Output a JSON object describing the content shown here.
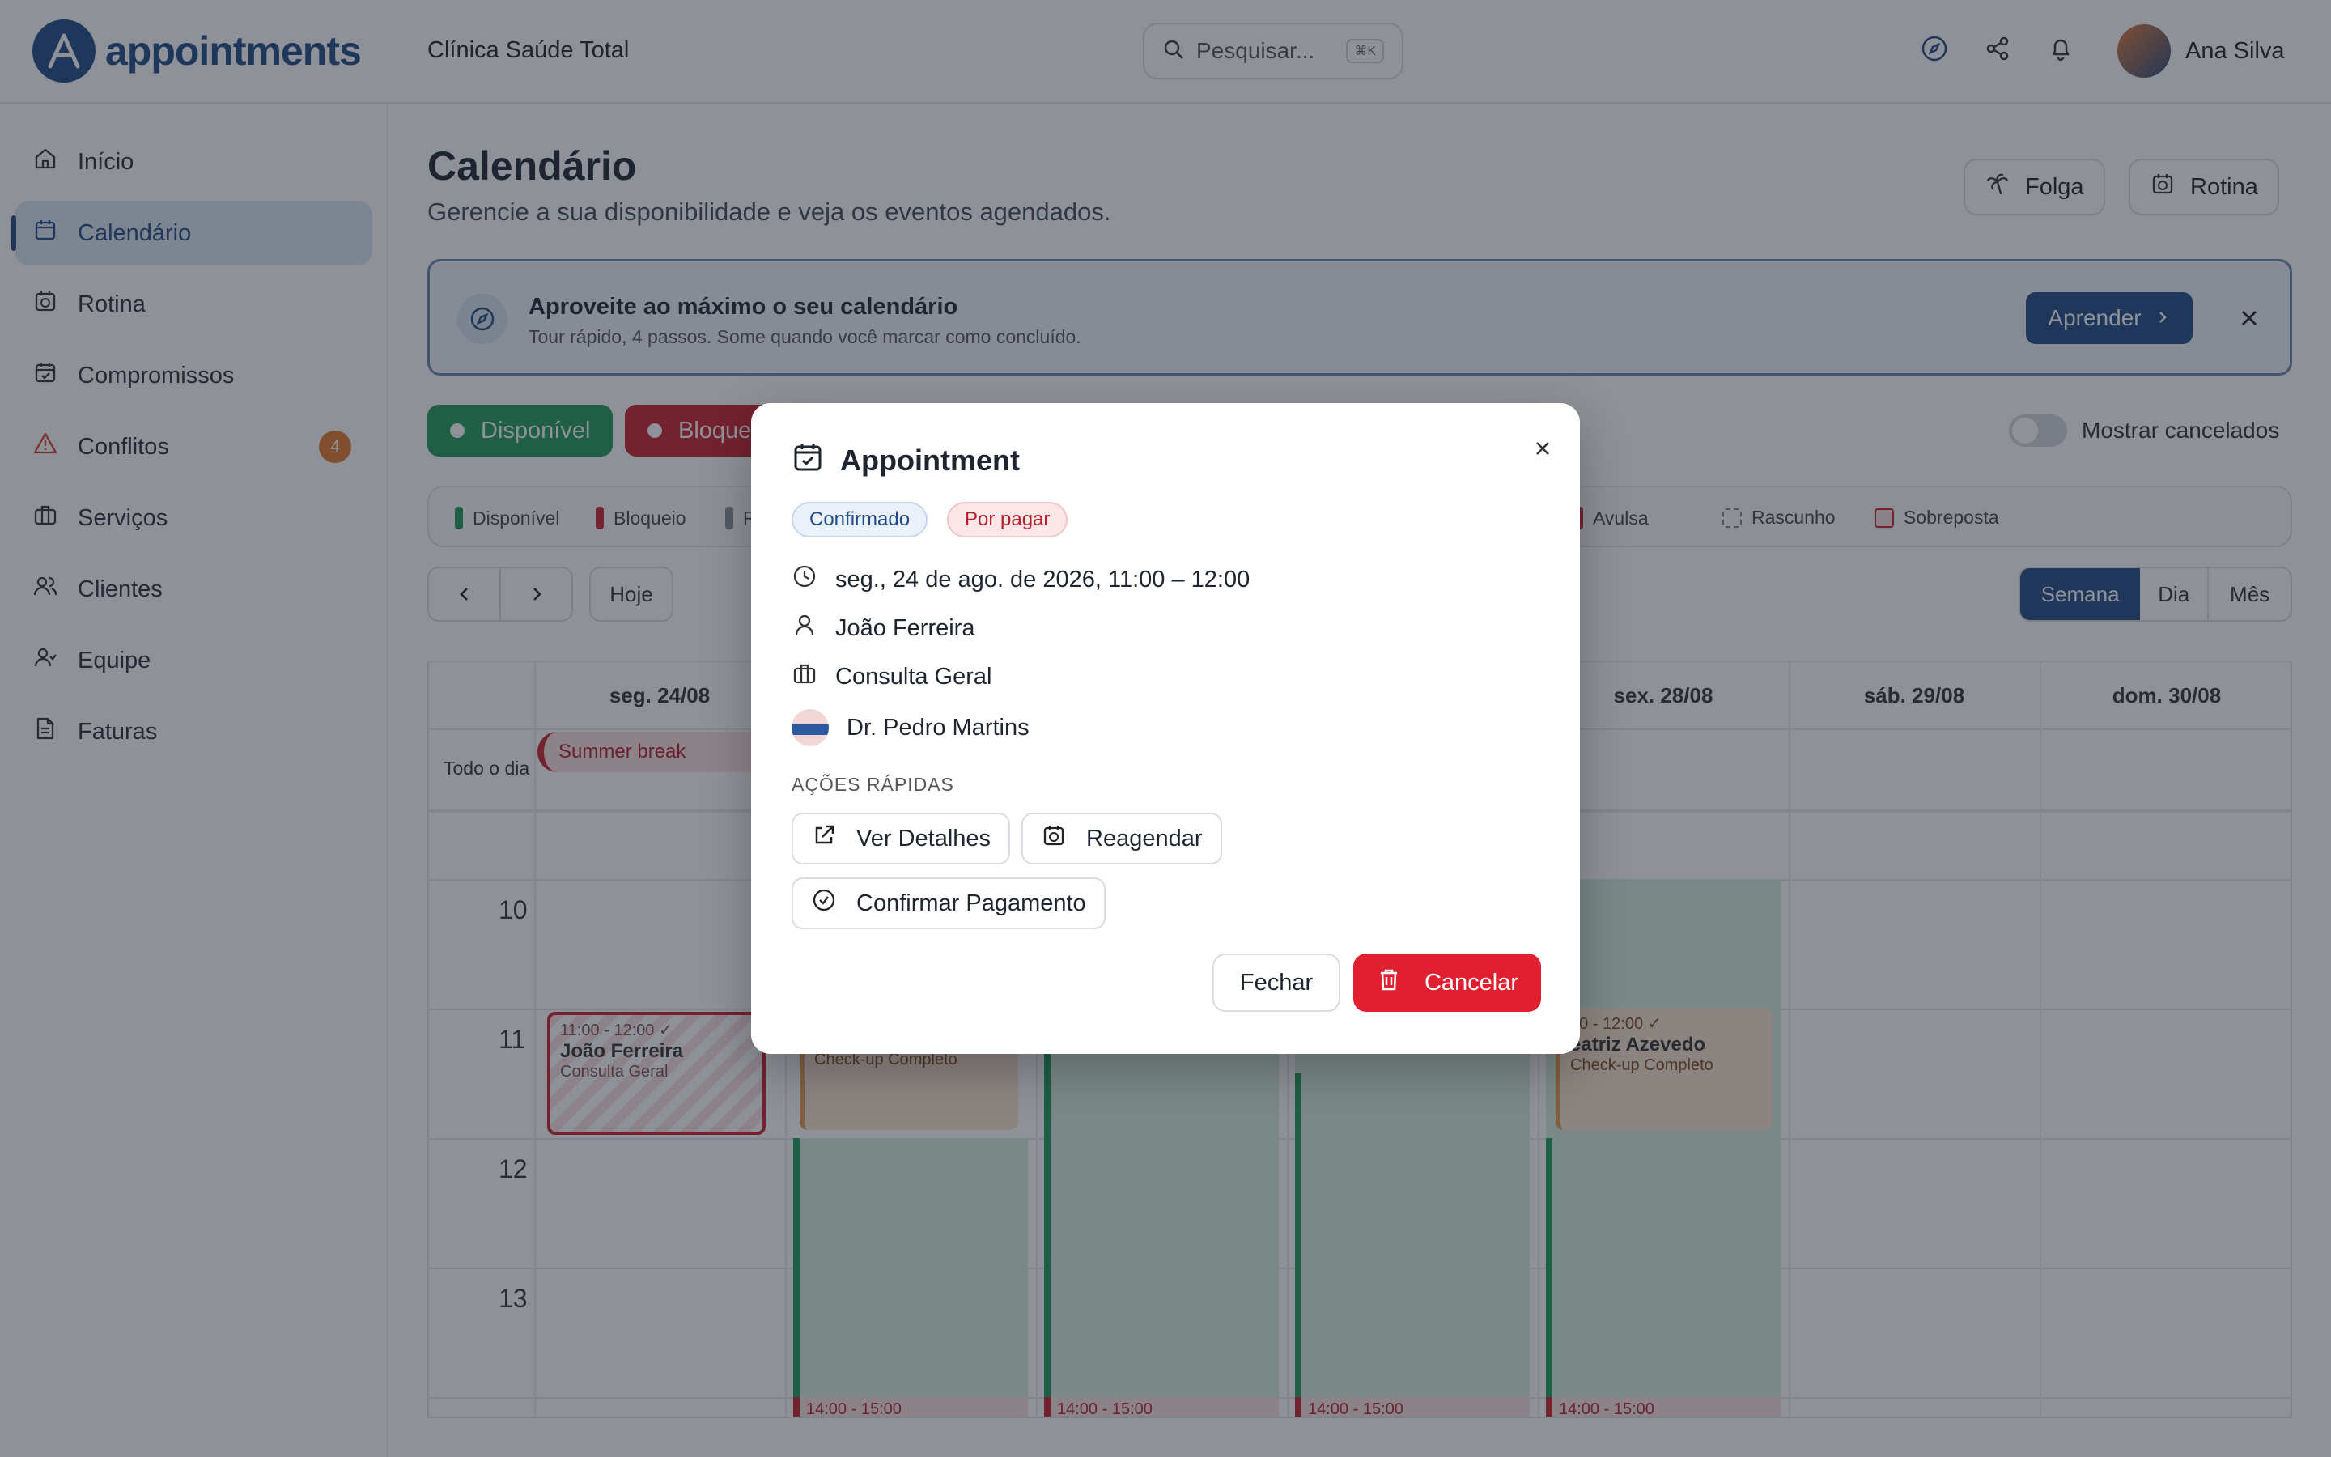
{
  "header": {
    "app_name": "appointments",
    "org_name": "Clínica Saúde Total",
    "search_placeholder": "Pesquisar...",
    "search_shortcut": "⌘K",
    "user_name": "Ana Silva"
  },
  "sidebar": {
    "items": [
      {
        "label": "Início"
      },
      {
        "label": "Calendário"
      },
      {
        "label": "Rotina"
      },
      {
        "label": "Compromissos"
      },
      {
        "label": "Conflitos",
        "badge": "4"
      },
      {
        "label": "Serviços"
      },
      {
        "label": "Clientes"
      },
      {
        "label": "Equipe"
      },
      {
        "label": "Faturas"
      }
    ]
  },
  "main": {
    "title": "Calendário",
    "subtitle": "Gerencie a sua disponibilidade e veja os eventos agendados.",
    "folga_label": "Folga",
    "rotina_label": "Rotina",
    "tour": {
      "title": "Aproveite ao máximo o seu calendário",
      "subtitle": "Tour rápido, 4 passos. Some quando você marcar como concluído.",
      "button": "Aprender"
    },
    "chips": {
      "disponivel": "Disponível",
      "bloqueio": "Bloque"
    },
    "show_cancelled": "Mostrar cancelados",
    "legend": {
      "disponivel": "Disponível",
      "bloqueio": "Bloqueio",
      "r": "R",
      "avulsa": "Avulsa",
      "rascunho": "Rascunho",
      "sobreposta": "Sobreposta"
    },
    "today": "Hoje",
    "views": {
      "semana": "Semana",
      "dia": "Dia",
      "mes": "Mês"
    }
  },
  "calendar": {
    "days": [
      "seg. 24/08",
      "sex. 28/08",
      "sáb. 29/08",
      "dom. 30/08"
    ],
    "all_day_label": "Todo o dia",
    "summer_break": "Summer break",
    "hours": [
      "10",
      "11",
      "12",
      "13"
    ],
    "events": {
      "mon_time": "11:00 - 12:00 ✓",
      "mon_name": "João Ferreira",
      "mon_service": "Consulta Geral",
      "tue_service": "Check-up Completo",
      "fri_time": "00 - 12:00 ✓",
      "fri_name": "eatriz Azevedo",
      "fri_service": "Check-up Completo",
      "bottom_time": "14:00 - 15:00"
    }
  },
  "modal": {
    "title": "Appointment",
    "tag_status": "Confirmado",
    "tag_payment": "Por pagar",
    "datetime": "seg., 24 de ago. de 2026, 11:00 – 12:00",
    "client": "João Ferreira",
    "service": "Consulta Geral",
    "staff": "Dr. Pedro Martins",
    "quick_actions": "AÇÕES RÁPIDAS",
    "details": "Ver Detalhes",
    "reschedule": "Reagendar",
    "confirm_payment": "Confirmar Pagamento",
    "close": "Fechar",
    "cancel": "Cancelar"
  },
  "colors": {
    "primary": "#1f4b86",
    "available": "#1e9a5a",
    "blocked": "#c8202e",
    "danger": "#e01f2f",
    "warning": "#e57b2f"
  }
}
